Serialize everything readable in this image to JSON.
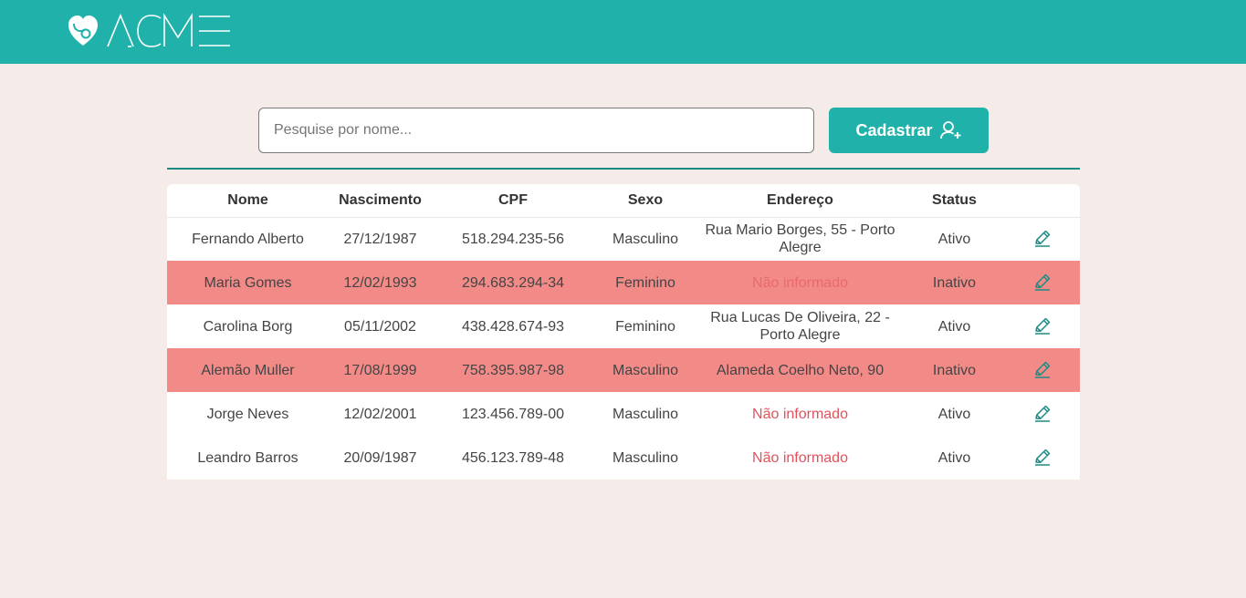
{
  "header": {
    "logo_text": "ACME",
    "bg_color": "#20b2aa"
  },
  "search": {
    "placeholder": "Pesquise por nome...",
    "value": ""
  },
  "add_button": {
    "label": "Cadastrar",
    "icon": "user-plus-icon"
  },
  "table": {
    "columns": [
      "Nome",
      "Nascimento",
      "CPF",
      "Sexo",
      "Endereço",
      "Status",
      ""
    ],
    "rows": [
      {
        "nome": "Fernando Alberto",
        "nascimento": "27/12/1987",
        "cpf": "518.294.235-56",
        "sexo": "Masculino",
        "endereco": "Rua Mario Borges, 55 - Porto Alegre",
        "status": "Ativo",
        "inactive": false,
        "missing": false
      },
      {
        "nome": "Maria Gomes",
        "nascimento": "12/02/1993",
        "cpf": "294.683.294-34",
        "sexo": "Feminino",
        "endereco": "Não informado",
        "status": "Inativo",
        "inactive": true,
        "missing": true
      },
      {
        "nome": "Carolina Borg",
        "nascimento": "05/11/2002",
        "cpf": "438.428.674-93",
        "sexo": "Feminino",
        "endereco": "Rua Lucas De Oliveira, 22 - Porto Alegre",
        "status": "Ativo",
        "inactive": false,
        "missing": false
      },
      {
        "nome": "Alemão Muller",
        "nascimento": "17/08/1999",
        "cpf": "758.395.987-98",
        "sexo": "Masculino",
        "endereco": "Alameda Coelho Neto, 90",
        "status": "Inativo",
        "inactive": true,
        "missing": false
      },
      {
        "nome": "Jorge Neves",
        "nascimento": "12/02/2001",
        "cpf": "123.456.789-00",
        "sexo": "Masculino",
        "endereco": "Não informado",
        "status": "Ativo",
        "inactive": false,
        "missing": true
      },
      {
        "nome": "Leandro Barros",
        "nascimento": "20/09/1987",
        "cpf": "456.123.789-48",
        "sexo": "Masculino",
        "endereco": "Não informado",
        "status": "Ativo",
        "inactive": false,
        "missing": true
      }
    ],
    "edit_icon": "pencil-icon"
  },
  "colors": {
    "accent": "#20b2aa",
    "inactive_row": "#f28b88",
    "missing_text": "#e0535e",
    "background": "#f5ebe8"
  }
}
